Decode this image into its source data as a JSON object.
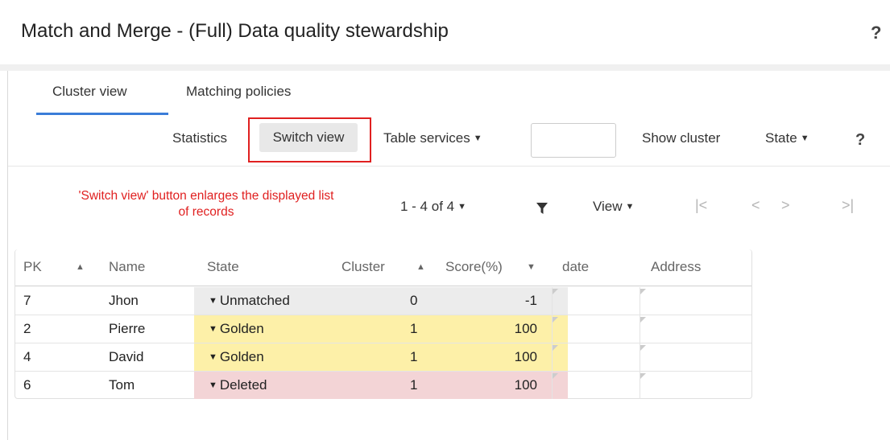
{
  "header": {
    "title": "Match and Merge - (Full) Data quality stewardship",
    "help": "?"
  },
  "tabs": [
    {
      "label": "Cluster view",
      "active": true
    },
    {
      "label": "Matching policies",
      "active": false
    }
  ],
  "toolbar": {
    "statistics": "Statistics",
    "switch_view": "Switch view",
    "table_services": "Table services",
    "search_value": "",
    "show_cluster": "Show cluster",
    "state": "State",
    "help": "?"
  },
  "annotation": {
    "line1": "'Switch view' button enlarges the displayed list",
    "line2": "of records"
  },
  "pager": {
    "range": "1 - 4 of 4",
    "view": "View"
  },
  "columns": {
    "pk": "PK",
    "name": "Name",
    "state": "State",
    "cluster": "Cluster",
    "score": "Score(%)",
    "date": "date",
    "address": "Address"
  },
  "rows": [
    {
      "pk": "7",
      "name": "Jhon",
      "state": "Unmatched",
      "cluster": "0",
      "score": "-1",
      "date": "",
      "address": ""
    },
    {
      "pk": "2",
      "name": "Pierre",
      "state": "Golden",
      "cluster": "1",
      "score": "100",
      "date": "",
      "address": ""
    },
    {
      "pk": "4",
      "name": "David",
      "state": "Golden",
      "cluster": "1",
      "score": "100",
      "date": "",
      "address": ""
    },
    {
      "pk": "6",
      "name": "Tom",
      "state": "Deleted",
      "cluster": "1",
      "score": "100",
      "date": "",
      "address": ""
    }
  ],
  "colors": {
    "accent": "#3b7dd8",
    "highlight_red": "#e02020",
    "unmatched_bg": "#ececec",
    "golden_bg": "#fdf0a8",
    "deleted_bg": "#f3d4d6"
  },
  "icons": {
    "filter": "filter-icon",
    "first_page": "first-page-icon",
    "prev_page": "prev-page-icon",
    "next_page": "next-page-icon",
    "last_page": "last-page-icon"
  }
}
